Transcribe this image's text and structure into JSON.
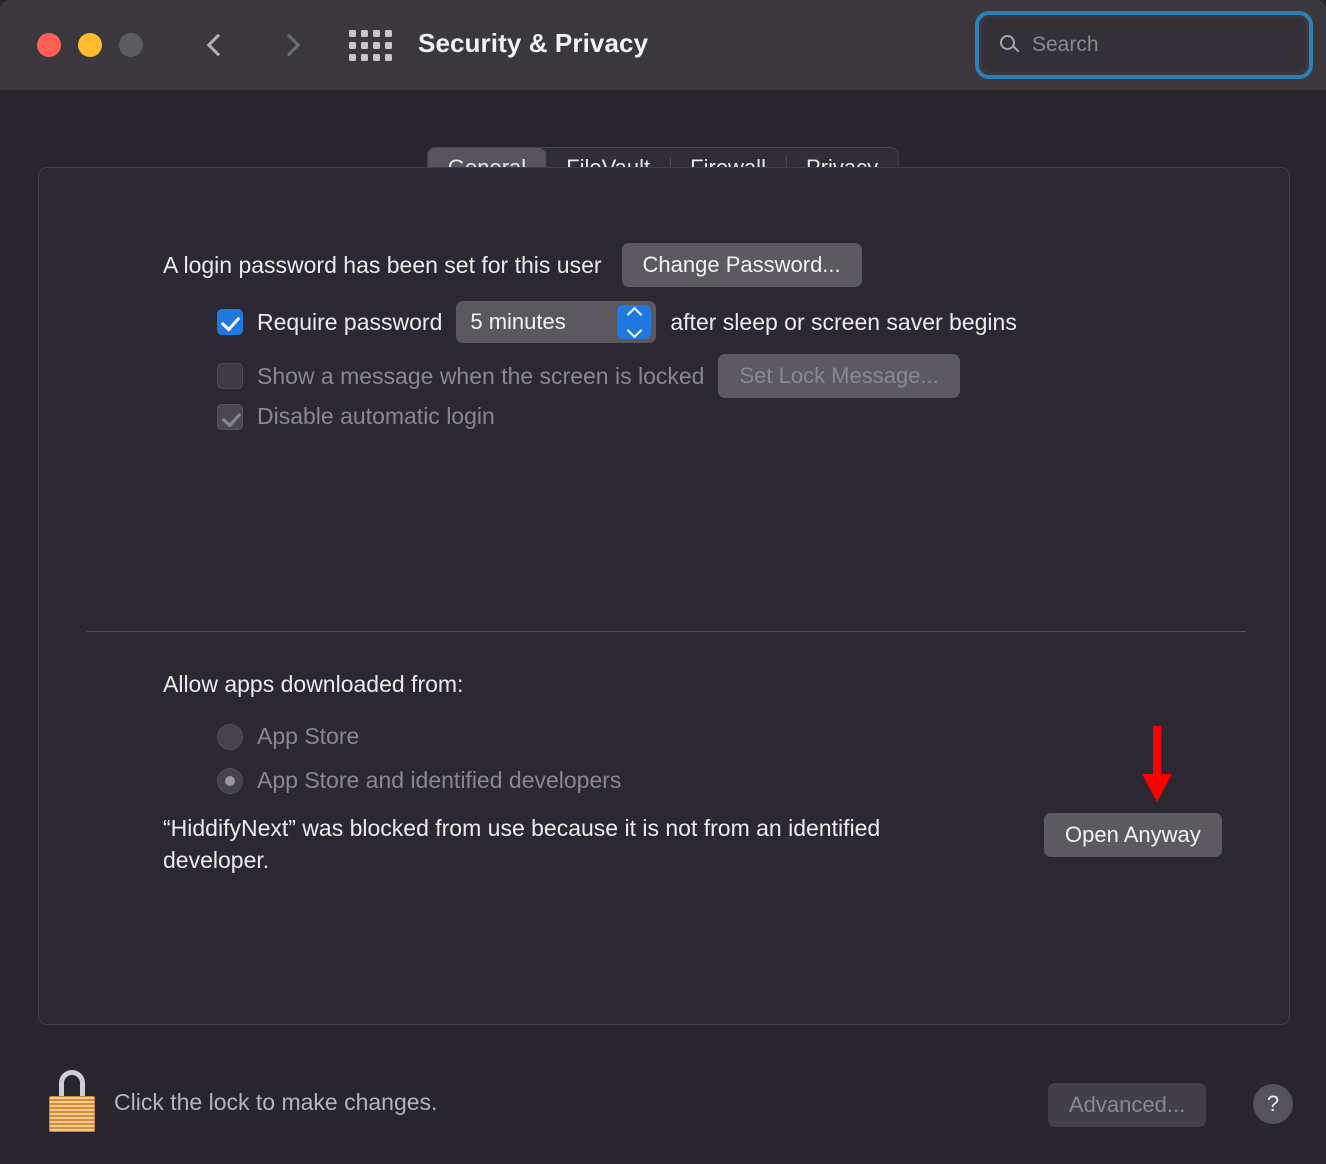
{
  "window": {
    "title": "Security & Privacy",
    "traffic_lights": [
      "close",
      "minimize",
      "zoom"
    ],
    "back_icon": "chevron-left-icon",
    "forward_icon": "chevron-right-icon",
    "grid_icon": "grid-view-icon",
    "accent_focus_color": "#2e7fb5"
  },
  "search": {
    "placeholder": "Search",
    "value": "",
    "icon": "search-icon"
  },
  "tabs": [
    {
      "label": "General",
      "active": true
    },
    {
      "label": "FileVault",
      "active": false
    },
    {
      "label": "Firewall",
      "active": false
    },
    {
      "label": "Privacy",
      "active": false
    }
  ],
  "general": {
    "password_status": "A login password has been set for this user",
    "change_password_label": "Change Password...",
    "require_password": {
      "checked": true,
      "label": "Require password",
      "delay_value": "5 minutes",
      "suffix": "after sleep or screen saver begins"
    },
    "lock_message": {
      "checked": false,
      "disabled": true,
      "label": "Show a message when the screen is locked",
      "button_label": "Set Lock Message..."
    },
    "disable_auto_login": {
      "checked": true,
      "disabled": true,
      "label": "Disable automatic login"
    },
    "allow_apps_title": "Allow apps downloaded from:",
    "allow_options": [
      {
        "label": "App Store",
        "selected": false
      },
      {
        "label": "App Store and identified developers",
        "selected": true
      }
    ],
    "blocked_message": "“HiddifyNext” was blocked from use because it is not from an identified developer.",
    "open_anyway_label": "Open Anyway",
    "annotation_arrow": {
      "icon": "down-arrow-annotation-icon",
      "color": "#ff0000",
      "points_to": "Open Anyway"
    }
  },
  "footer": {
    "lock_icon": "padlock-locked-icon",
    "lock_text": "Click the lock to make changes.",
    "advanced_label": "Advanced...",
    "advanced_disabled": true,
    "help_label": "?"
  }
}
